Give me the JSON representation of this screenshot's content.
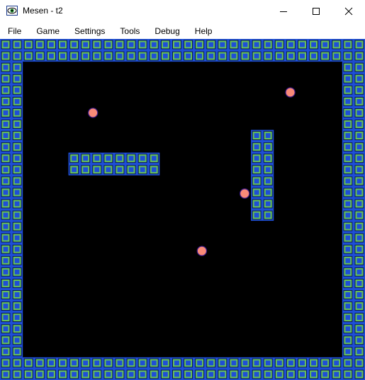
{
  "window": {
    "title": "Mesen - t2",
    "controls": {
      "minimize_icon": "minimize-icon",
      "maximize_icon": "maximize-icon",
      "close_icon": "close-icon"
    }
  },
  "menu": {
    "items": [
      "File",
      "Game",
      "Settings",
      "Tools",
      "Debug",
      "Help"
    ]
  },
  "game": {
    "colors": {
      "background": "#000000",
      "tile_outer": "#1e4fd6",
      "tile_inner": "#68c25a",
      "tile_core": "#1e4fd6",
      "tile_dark": "#0b1a4a",
      "ball_fill": "#f98a78",
      "ball_edge": "#3a1a8a"
    },
    "playfield": {
      "cols": 32,
      "rows": 30
    },
    "walls": [
      {
        "name": "top-border",
        "col": 0,
        "row": 0,
        "w": 32,
        "h": 2
      },
      {
        "name": "bottom-border",
        "col": 0,
        "row": 28,
        "w": 32,
        "h": 2
      },
      {
        "name": "left-border",
        "col": 0,
        "row": 2,
        "w": 2,
        "h": 26
      },
      {
        "name": "right-border",
        "col": 30,
        "row": 2,
        "w": 2,
        "h": 26
      },
      {
        "name": "horizontal-block",
        "col": 6,
        "row": 10,
        "w": 8,
        "h": 2
      },
      {
        "name": "vertical-block",
        "col": 22,
        "row": 8,
        "w": 2,
        "h": 8
      }
    ],
    "balls": [
      {
        "name": "ball-1",
        "col": 8.15,
        "row": 6.5
      },
      {
        "name": "ball-2",
        "col": 25.45,
        "row": 4.7
      },
      {
        "name": "ball-3",
        "col": 21.45,
        "row": 13.6
      },
      {
        "name": "ball-4",
        "col": 17.7,
        "row": 18.65
      }
    ]
  }
}
